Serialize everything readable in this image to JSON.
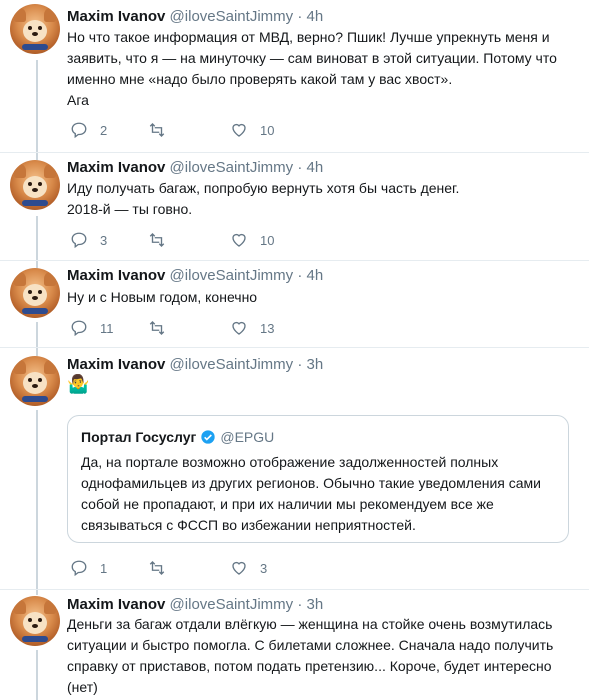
{
  "user": {
    "name": "Maxim Ivanov",
    "handle": "@iloveSaintJimmy",
    "separator": "·"
  },
  "tweets": [
    {
      "time": "4h",
      "lines": [
        "Но что такое информация от МВД, верно? Пшик! Лучше упрекнуть меня и",
        "заявить, что я — на минуточку — сам виноват в этой ситуации. Потому что",
        "именно мне «надо было проверять какой там у вас хвост».",
        "Ага"
      ],
      "replies": "2",
      "retweets": "",
      "likes": "10"
    },
    {
      "time": "4h",
      "lines": [
        "Иду получать багаж, попробую вернуть хотя бы часть денег.",
        "2018-й — ты говно."
      ],
      "replies": "3",
      "retweets": "",
      "likes": "10"
    },
    {
      "time": "4h",
      "lines": [
        "Ну и с Новым годом, конечно"
      ],
      "replies": "11",
      "retweets": "",
      "likes": "13"
    },
    {
      "time": "3h",
      "emoji": "🤷‍♂️",
      "quote": {
        "name": "Портал Госуслуг",
        "handle": "@EPGU",
        "lines": [
          "Да, на портале возможно отображение задолженностей полных",
          "однофамильцев из других регионов. Обычно такие уведомления сами",
          "собой не пропадают, и при их наличии мы рекомендуем все же",
          "связываться с ФССП во избежании неприятностей."
        ]
      },
      "replies": "1",
      "retweets": "",
      "likes": "3"
    },
    {
      "time": "3h",
      "lines": [
        "Деньги за багаж отдали влёгкую — женщина на стойке очень возмутилась",
        "ситуации и быстро помогла. С билетами сложнее. Сначала надо получить",
        "справку от приставов, потом подать претензию... Короче, будет интересно",
        "(нет)"
      ]
    }
  ],
  "icons": {
    "reply": "reply-icon",
    "retweet": "retweet-icon",
    "like": "heart-icon",
    "verified": "verified-badge-icon"
  },
  "colors": {
    "text": "#14171a",
    "secondary": "#657786",
    "verified": "#1da1f2",
    "thread_line": "#ccd6dd"
  }
}
